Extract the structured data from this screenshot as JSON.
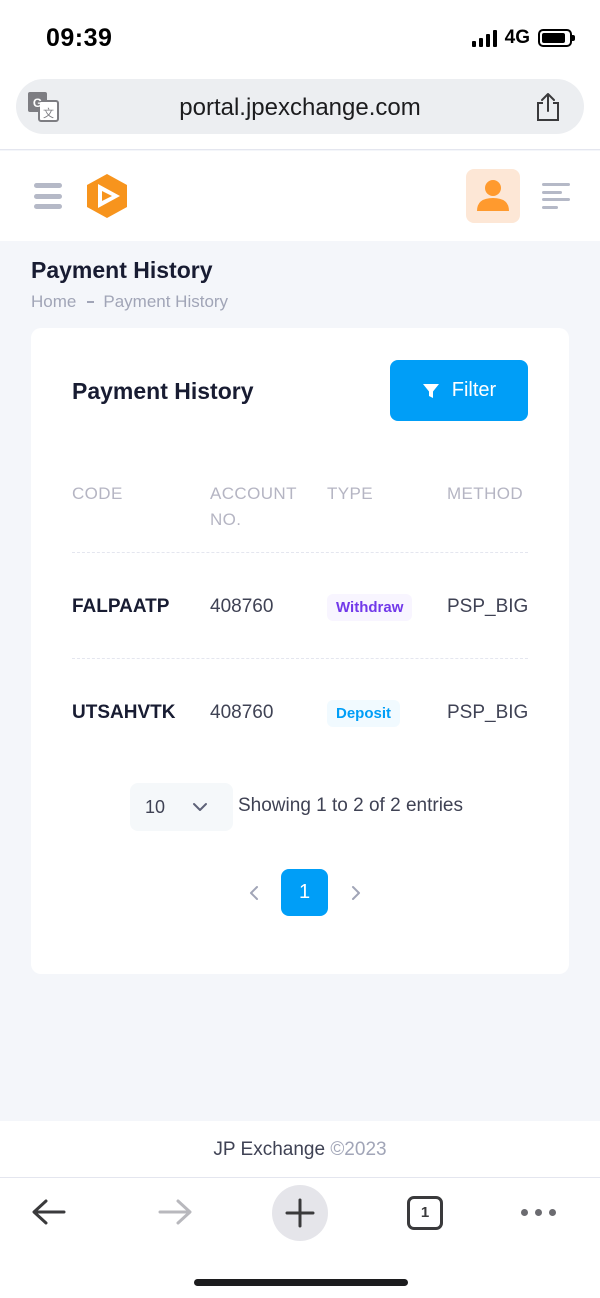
{
  "status_bar": {
    "time": "09:39",
    "network": "4G",
    "battery_level": 0.9
  },
  "browser": {
    "url": "portal.jpexchange.com",
    "tab_count": "1"
  },
  "page": {
    "title": "Payment History",
    "breadcrumb": [
      "Home",
      "Payment History"
    ]
  },
  "card": {
    "title": "Payment History",
    "filter_label": "Filter",
    "columns": [
      "CODE",
      "ACCOUNT\nNO.",
      "TYPE",
      "METHOD"
    ],
    "rows": [
      {
        "code": "FALPAATP",
        "account_no": "408760",
        "type": "Withdraw",
        "method": "PSP_BIG"
      },
      {
        "code": "UTSAHVTK",
        "account_no": "408760",
        "type": "Deposit",
        "method": "PSP_BIG"
      }
    ],
    "per_page": "10",
    "showing_text": "Showing 1 to 2 of 2 entries",
    "current_page": "1"
  },
  "footer": {
    "brand": "JP Exchange",
    "copyright": "©2023"
  },
  "colors": {
    "primary": "#009ef7",
    "withdraw": "#7239ea",
    "logo_orange": "#f7941d",
    "avatar_orange": "#ff9a2e"
  },
  "icons": [
    "translate-icon",
    "share-icon",
    "hamburger-icon",
    "app-logo",
    "user-avatar-icon",
    "menu-icon",
    "filter-icon",
    "chevron-down-icon",
    "chevron-left-icon",
    "chevron-right-icon",
    "back-arrow-icon",
    "forward-arrow-icon",
    "plus-icon",
    "more-icon"
  ]
}
